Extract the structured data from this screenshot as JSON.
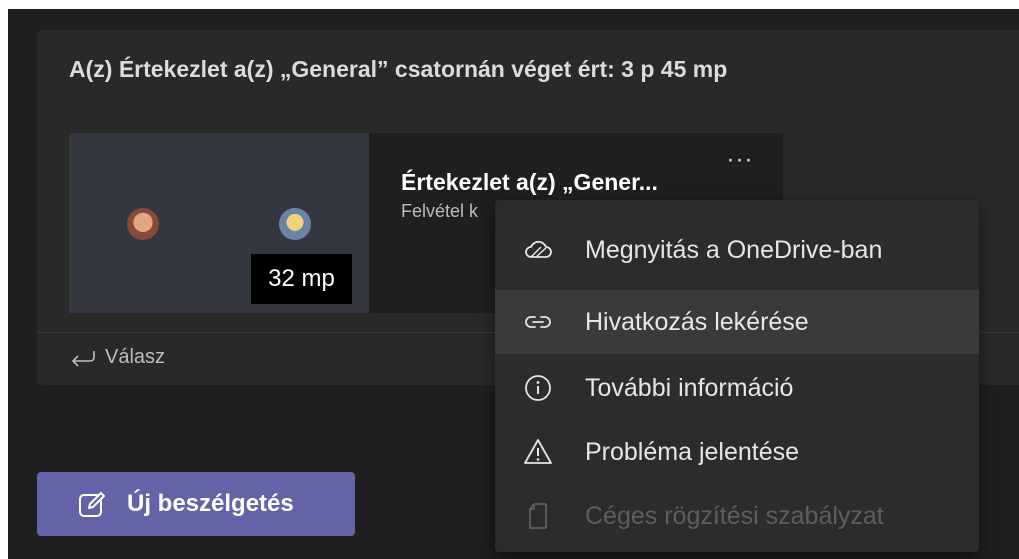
{
  "post": {
    "title": "A(z) Értekezlet a(z) „General” csatornán véget ért: 3 p 45 mp",
    "recording": {
      "title": "Értekezlet a(z) „Gener...",
      "subtitle": "Felvétel k",
      "duration": "32 mp",
      "more_label": "···"
    },
    "reply_label": "Válasz"
  },
  "new_conversation": {
    "label": "Új beszélgetés",
    "icon": "compose-icon"
  },
  "context_menu": {
    "items": [
      {
        "label": "Megnyitás a OneDrive-ban",
        "icon": "onedrive-cloud-icon",
        "state": "normal"
      },
      {
        "label": "Hivatkozás lekérése",
        "icon": "link-icon",
        "state": "hover"
      },
      {
        "label": "További információ",
        "icon": "info-icon",
        "state": "normal"
      },
      {
        "label": "Probléma jelentése",
        "icon": "warning-icon",
        "state": "normal"
      },
      {
        "label": "Céges rögzítési szabályzat",
        "icon": "document-icon",
        "state": "disabled"
      }
    ]
  },
  "colors": {
    "background": "#1f1f1f",
    "card": "#292929",
    "accent": "#6264a7",
    "menu": "#2d2c2c",
    "menu_hover": "#3b3a39"
  }
}
